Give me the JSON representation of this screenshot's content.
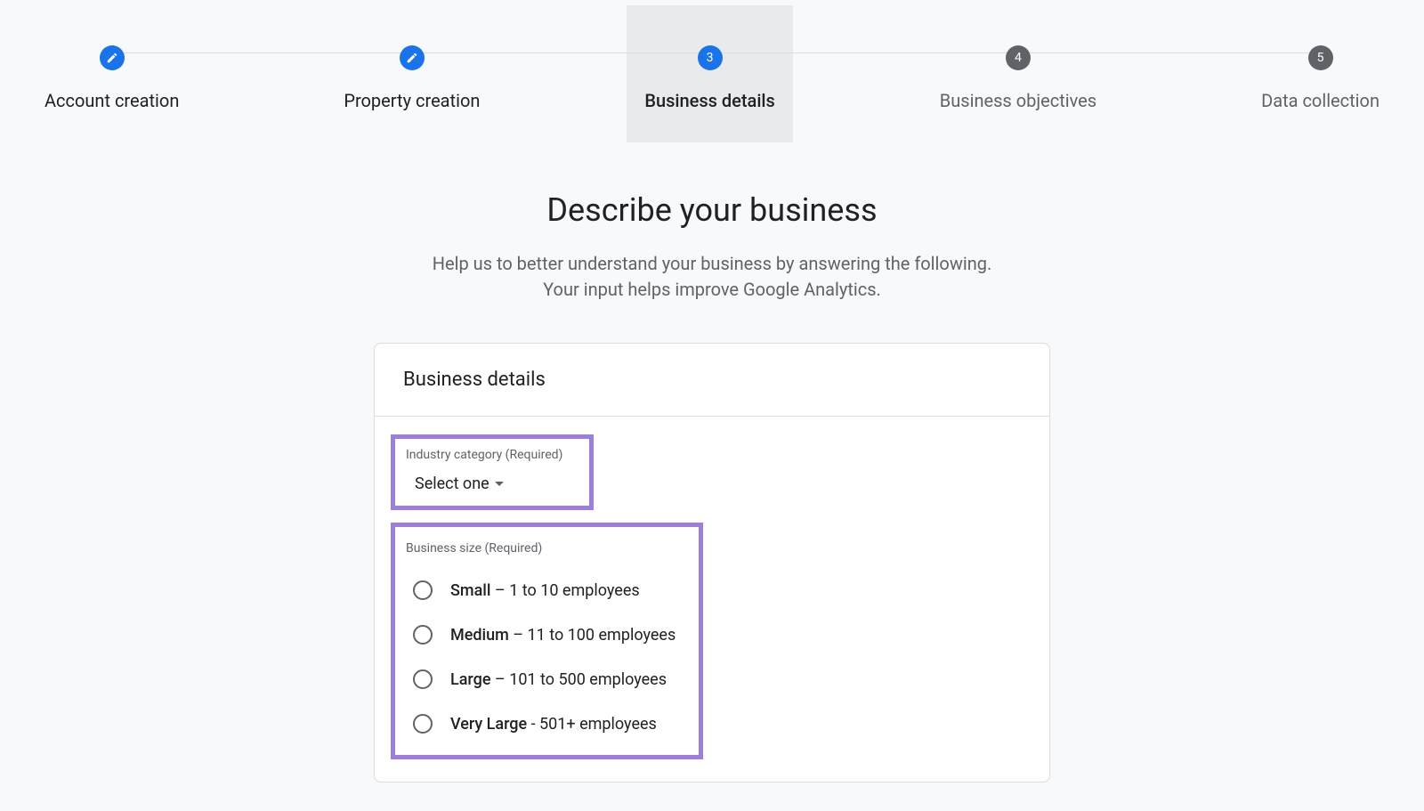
{
  "stepper": {
    "steps": [
      {
        "label": "Account creation",
        "state": "done"
      },
      {
        "label": "Property creation",
        "state": "done"
      },
      {
        "label": "Business details",
        "state": "current",
        "number": "3"
      },
      {
        "label": "Business objectives",
        "state": "pending",
        "number": "4"
      },
      {
        "label": "Data collection",
        "state": "pending",
        "number": "5"
      }
    ]
  },
  "page": {
    "heading": "Describe your business",
    "subtext_line1": "Help us to better understand your business by answering the following.",
    "subtext_line2": "Your input helps improve Google Analytics."
  },
  "card": {
    "title": "Business details",
    "industry": {
      "label": "Industry category (Required)",
      "select_text": "Select one"
    },
    "size": {
      "label": "Business size (Required)",
      "options": [
        {
          "name": "Small",
          "desc": " – 1 to 10 employees"
        },
        {
          "name": "Medium",
          "desc": " – 11 to 100 employees"
        },
        {
          "name": "Large",
          "desc": " – 101 to 500 employees"
        },
        {
          "name": "Very Large",
          "desc": " - 501+ employees"
        }
      ]
    }
  }
}
